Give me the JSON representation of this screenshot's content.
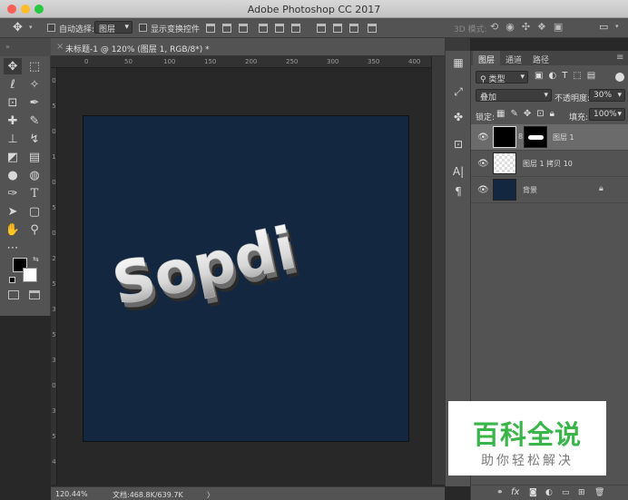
{
  "window": {
    "title": "Adobe Photoshop CC 2017"
  },
  "options_bar": {
    "auto_select_label": "自动选择:",
    "auto_select_value": "图层",
    "show_transform_label": "显示变换控件",
    "mode_3d_label": "3D 模式:"
  },
  "document": {
    "tab_title": "未标题-1 @ 120% (图层 1, RGB/8*) *",
    "close_glyph": "×",
    "canvas_color": "#142740",
    "text_art": "Sopdi"
  },
  "ruler": {
    "h_ticks": [
      "0",
      "50",
      "100",
      "150",
      "200",
      "250",
      "300",
      "350",
      "400"
    ],
    "v_ticks": [
      "0",
      "5",
      "0",
      "1",
      "0",
      "5",
      "0",
      "2",
      "5",
      "3",
      "5",
      "3",
      "0",
      "3",
      "5",
      "4"
    ]
  },
  "status": {
    "zoom": "120.44%",
    "doc_info": "文档:468.8K/639.7K",
    "arrow": "〉"
  },
  "layers_panel": {
    "tabs": [
      "图层",
      "通道",
      "路径"
    ],
    "filter_label": "类型",
    "blend_mode": "叠加",
    "opacity_label": "不透明度:",
    "opacity_value": "30%",
    "lock_label": "锁定:",
    "fill_label": "填充:",
    "fill_value": "100%",
    "layers": [
      {
        "name": "图层 1",
        "selected": true
      },
      {
        "name": "图层 1 拷贝 10",
        "selected": false
      },
      {
        "name": "背景",
        "selected": false
      }
    ],
    "footer_icons": [
      "link-icon",
      "fx-icon",
      "mask-icon",
      "adjustment-icon",
      "group-icon",
      "new-layer-icon",
      "trash-icon"
    ],
    "fx_label": "fx"
  },
  "watermark": {
    "title": "百科全说",
    "subtitle": "助你轻松解决"
  },
  "colors": {
    "accent_green": "#3ab54a",
    "ui_panel": "#535353",
    "ui_dark": "#282828"
  }
}
